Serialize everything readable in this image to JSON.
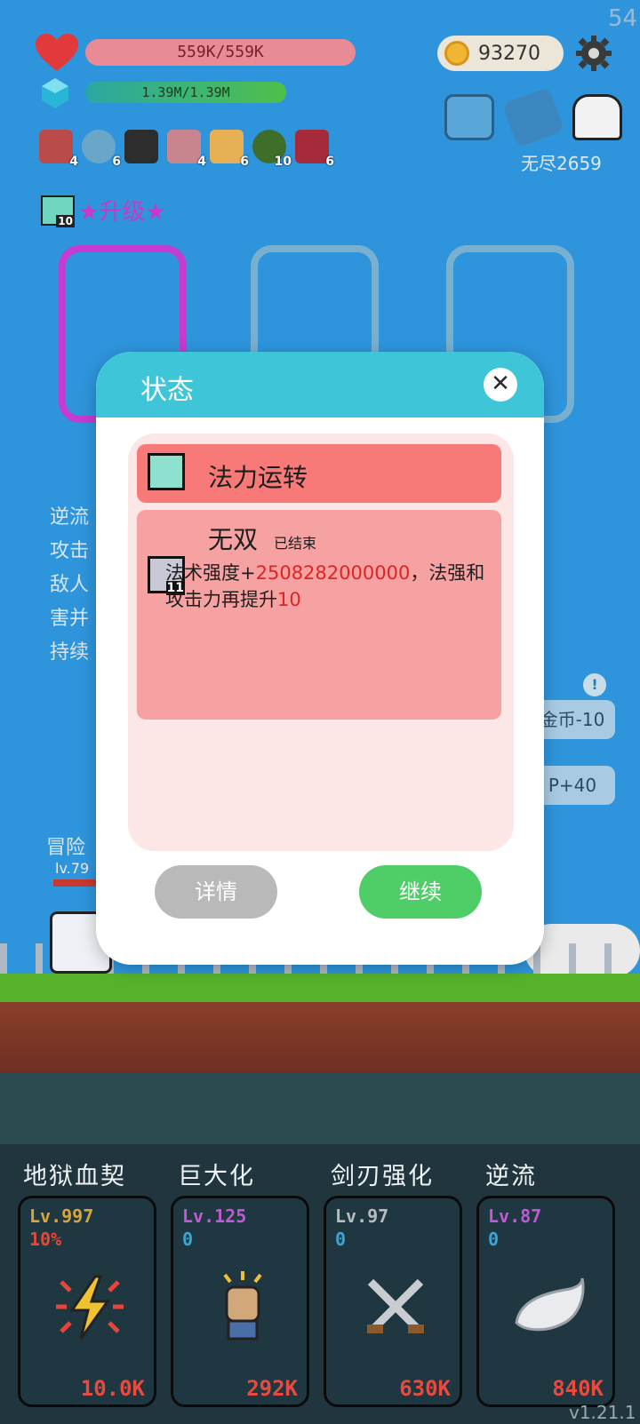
{
  "status_bar": {
    "fps": "54"
  },
  "player": {
    "hp_text": "559K/559K",
    "mp_text": "1.39M/1.39M",
    "coins": "93270",
    "endless_label": "无尽2659"
  },
  "buffs": [
    {
      "icon": "armor-icon",
      "count": "4"
    },
    {
      "icon": "swirl-icon",
      "count": "6"
    },
    {
      "icon": "sword-icon",
      "count": ""
    },
    {
      "icon": "hook-icon",
      "count": "4"
    },
    {
      "icon": "scroll-icon",
      "count": "6"
    },
    {
      "icon": "eye-icon",
      "count": "10"
    },
    {
      "icon": "demon-icon",
      "count": "6"
    }
  ],
  "upgrade": {
    "badge": "10",
    "label": "★升级★"
  },
  "side_text": [
    "逆流",
    "攻击",
    "敌人",
    "害并",
    "持续"
  ],
  "adventure": {
    "label": "冒险",
    "level": "lv.79"
  },
  "right_pills": [
    "金币-10",
    "P+40"
  ],
  "skills": [
    {
      "title": "地狱血契",
      "level": "Lv.997",
      "sub": "10%",
      "cost": "10.0K",
      "level_color": "#d6a63a",
      "sub_color": "#e9463a",
      "icon": "lightning-icon"
    },
    {
      "title": "巨大化",
      "level": "Lv.125",
      "sub": "0",
      "cost": "292K",
      "level_color": "#c05ad4",
      "sub_color": "#3aa6d6",
      "icon": "fist-icon"
    },
    {
      "title": "剑刃强化",
      "level": "Lv.97",
      "sub": "0",
      "cost": "630K",
      "level_color": "#b8bcc0",
      "sub_color": "#3aa6d6",
      "icon": "crossed-swords-icon"
    },
    {
      "title": "逆流",
      "level": "Lv.87",
      "sub": "0",
      "cost": "840K",
      "level_color": "#c05ad4",
      "sub_color": "#3aa6d6",
      "icon": "wing-icon"
    }
  ],
  "version": "v1.21.1",
  "modal": {
    "title": "状态",
    "close": "✕",
    "row1_label": "法力运转",
    "row2_label": "无双",
    "row2_status": "已结束",
    "row2_badge": "11",
    "desc_a": "法术强度+",
    "desc_num1": "2508282000000",
    "desc_b": "，法强和攻击力再提升",
    "desc_num2": "10",
    "btn_detail": "详情",
    "btn_continue": "继续"
  }
}
